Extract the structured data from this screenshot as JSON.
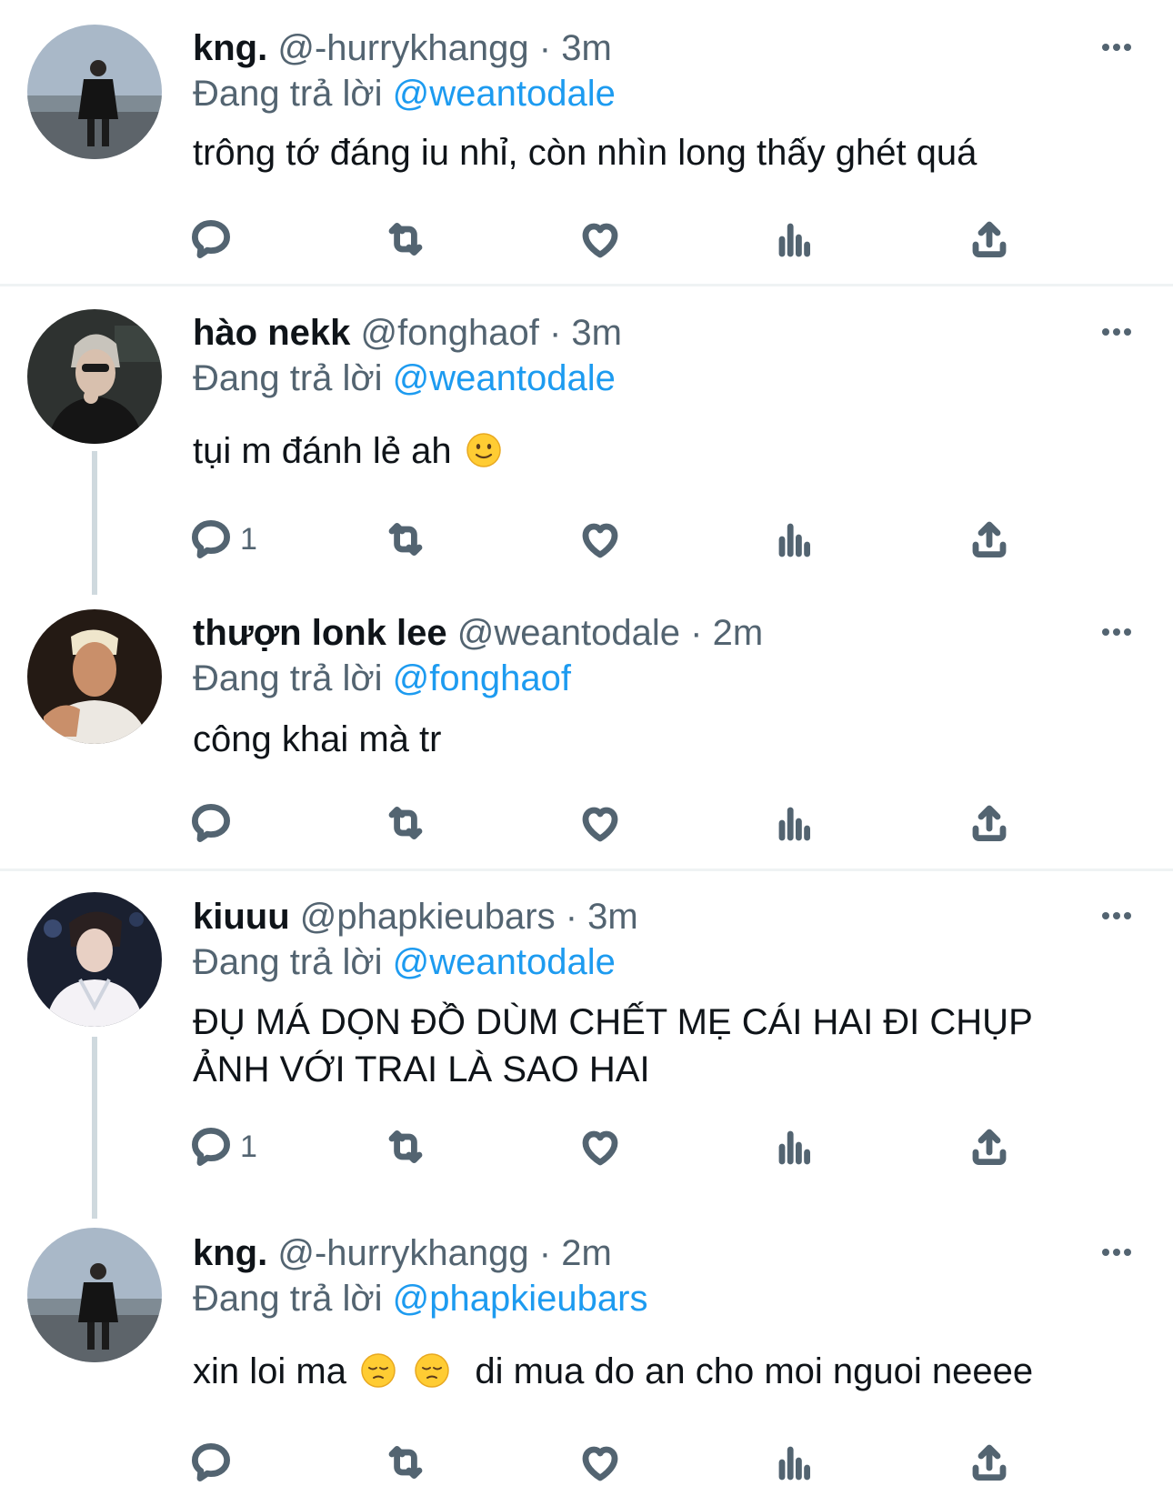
{
  "reply_prefix": "Đang trả lời",
  "tweets": [
    {
      "name": "kng.",
      "handle": "@-hurrykhangg",
      "sep": "·",
      "time": "3m",
      "reply_to": "@weantodale",
      "text": "trông tớ đáng iu nhỉ, còn nhìn long thấy ghét quá",
      "reply_count": ""
    },
    {
      "name": "hào nekk",
      "handle": "@fonghaof",
      "sep": "·",
      "time": "3m",
      "reply_to": "@weantodale",
      "text": "tụi m đánh lẻ ah",
      "emoji": "slightly-smiling-face",
      "reply_count": "1"
    },
    {
      "name": "thượn lonk lee",
      "handle": "@weantodale",
      "sep": "·",
      "time": "2m",
      "reply_to": "@fonghaof",
      "text": "công khai mà tr",
      "reply_count": ""
    },
    {
      "name": "kiuuu",
      "handle": "@phapkieubars",
      "sep": "·",
      "time": "3m",
      "reply_to": "@weantodale",
      "text": "ĐỤ MÁ DỌN ĐỒ DÙM CHẾT MẸ CÁI HAI ĐI CHỤP ẢNH VỚI TRAI LÀ SAO HAI",
      "reply_count": "1"
    },
    {
      "name": "kng.",
      "handle": "@-hurrykhangg",
      "sep": "·",
      "time": "2m",
      "reply_to": "@phapkieubars",
      "text_a": "xin loi ma",
      "text_b": "di mua do an cho moi nguoi neeee",
      "emoji": "pensive-face",
      "reply_count": ""
    }
  ],
  "colors": {
    "mention": "#1d9bf0",
    "secondary": "#536471",
    "divider": "#eff3f4"
  },
  "icons": [
    "reply-icon",
    "retweet-icon",
    "like-icon",
    "views-icon",
    "share-icon",
    "more-icon"
  ]
}
